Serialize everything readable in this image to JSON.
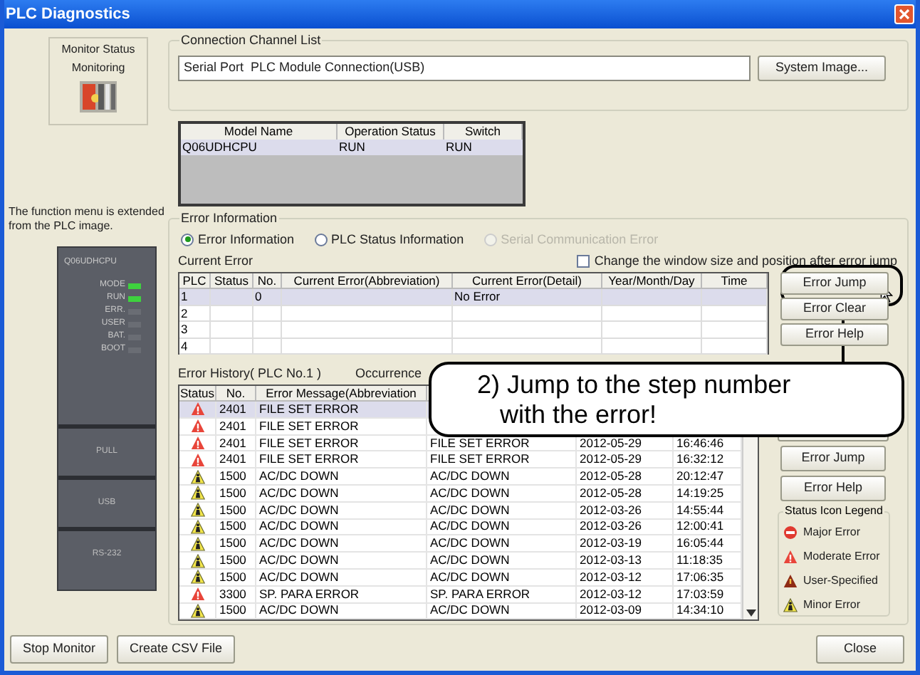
{
  "window": {
    "title": "PLC Diagnostics"
  },
  "monitor_status": {
    "title": "Monitor Status",
    "status": "Monitoring"
  },
  "note": "The function menu is extended from the PLC image.",
  "plc_module": {
    "model": "Q06UDHCPU",
    "leds": [
      {
        "label": "MODE",
        "on": true
      },
      {
        "label": "RUN",
        "on": true
      },
      {
        "label": "ERR.",
        "on": false
      },
      {
        "label": "USER",
        "on": false
      },
      {
        "label": "BAT.",
        "on": false
      },
      {
        "label": "BOOT",
        "on": false
      }
    ],
    "ports": [
      "PULL",
      "USB",
      "RS-232"
    ]
  },
  "connection": {
    "title": "Connection Channel List",
    "value": "Serial Port  PLC Module Connection(USB)",
    "button": "System Image..."
  },
  "module_table": {
    "columns": [
      "Model Name",
      "Operation Status",
      "Switch"
    ],
    "rows": [
      [
        "Q06UDHCPU",
        "RUN",
        "RUN"
      ]
    ]
  },
  "error_information": {
    "title": "Error Information",
    "modes": [
      {
        "label": "Error Information",
        "selected": true,
        "disabled": false
      },
      {
        "label": "PLC Status Information",
        "selected": false,
        "disabled": false
      },
      {
        "label": "Serial Communication Error",
        "selected": false,
        "disabled": true
      }
    ],
    "resize_option": {
      "label": "Change the window size and position after error jump",
      "checked": false
    },
    "current_error": {
      "title": "Current Error",
      "columns": [
        "PLC",
        "Status",
        "No.",
        "Current Error(Abbreviation)",
        "Current Error(Detail)",
        "Year/Month/Day",
        "Time"
      ],
      "rows": [
        {
          "plc": "1",
          "no": "0",
          "detail": "No Error",
          "selected": true
        },
        {
          "plc": "2",
          "selected": false
        },
        {
          "plc": "3",
          "selected": false
        },
        {
          "plc": "4",
          "selected": false
        }
      ],
      "buttons": [
        "Error Jump",
        "Error Clear",
        "Error Help"
      ]
    },
    "history": {
      "title": "Error History( PLC No.1 )",
      "occurrence_label": "Occurrence",
      "columns": [
        "Status",
        "No.",
        "Error Message(Abbreviation"
      ],
      "rows": [
        {
          "kind": "moderate",
          "no": "2401",
          "abbreviation": "FILE SET ERROR",
          "selected": true
        },
        {
          "kind": "moderate",
          "no": "2401",
          "abbreviation": "FILE SET ERROR",
          "selected": false
        },
        {
          "kind": "moderate",
          "no": "2401",
          "abbreviation": "FILE SET ERROR",
          "detail": "FILE SET ERROR",
          "date": "2012-05-29",
          "time": "16:46:46",
          "selected": false
        },
        {
          "kind": "moderate",
          "no": "2401",
          "abbreviation": "FILE SET ERROR",
          "detail": "FILE SET ERROR",
          "date": "2012-05-29",
          "time": "16:32:12",
          "selected": false
        },
        {
          "kind": "minor",
          "no": "1500",
          "abbreviation": "AC/DC DOWN",
          "detail": "AC/DC DOWN",
          "date": "2012-05-28",
          "time": "20:12:47",
          "selected": false
        },
        {
          "kind": "minor",
          "no": "1500",
          "abbreviation": "AC/DC DOWN",
          "detail": "AC/DC DOWN",
          "date": "2012-05-28",
          "time": "14:19:25",
          "selected": false
        },
        {
          "kind": "minor",
          "no": "1500",
          "abbreviation": "AC/DC DOWN",
          "detail": "AC/DC DOWN",
          "date": "2012-03-26",
          "time": "14:55:44",
          "selected": false
        },
        {
          "kind": "minor",
          "no": "1500",
          "abbreviation": "AC/DC DOWN",
          "detail": "AC/DC DOWN",
          "date": "2012-03-26",
          "time": "12:00:41",
          "selected": false
        },
        {
          "kind": "minor",
          "no": "1500",
          "abbreviation": "AC/DC DOWN",
          "detail": "AC/DC DOWN",
          "date": "2012-03-19",
          "time": "16:05:44",
          "selected": false
        },
        {
          "kind": "minor",
          "no": "1500",
          "abbreviation": "AC/DC DOWN",
          "detail": "AC/DC DOWN",
          "date": "2012-03-13",
          "time": "11:18:35",
          "selected": false
        },
        {
          "kind": "minor",
          "no": "1500",
          "abbreviation": "AC/DC DOWN",
          "detail": "AC/DC DOWN",
          "date": "2012-03-12",
          "time": "17:06:35",
          "selected": false
        },
        {
          "kind": "moderate",
          "no": "3300",
          "abbreviation": "SP. PARA ERROR",
          "detail": "SP. PARA ERROR",
          "date": "2012-03-12",
          "time": "17:03:59",
          "selected": false
        },
        {
          "kind": "minor",
          "no": "1500",
          "abbreviation": "AC/DC DOWN",
          "detail": "AC/DC DOWN",
          "date": "2012-03-09",
          "time": "14:34:10",
          "selected": false
        }
      ],
      "buttons": [
        "Error Jump",
        "Error Help"
      ],
      "legend": {
        "title": "Status Icon Legend",
        "items": [
          {
            "kind": "major",
            "label": "Major Error"
          },
          {
            "kind": "moderate",
            "label": "Moderate Error"
          },
          {
            "kind": "user",
            "label": "User-Specified"
          },
          {
            "kind": "minor",
            "label": "Minor Error"
          }
        ]
      }
    }
  },
  "callout": {
    "lines": [
      "2) Jump to the step number",
      "with the error!"
    ]
  },
  "footer": {
    "left_buttons": [
      "Stop Monitor",
      "Create CSV File"
    ],
    "close_button": "Close"
  }
}
